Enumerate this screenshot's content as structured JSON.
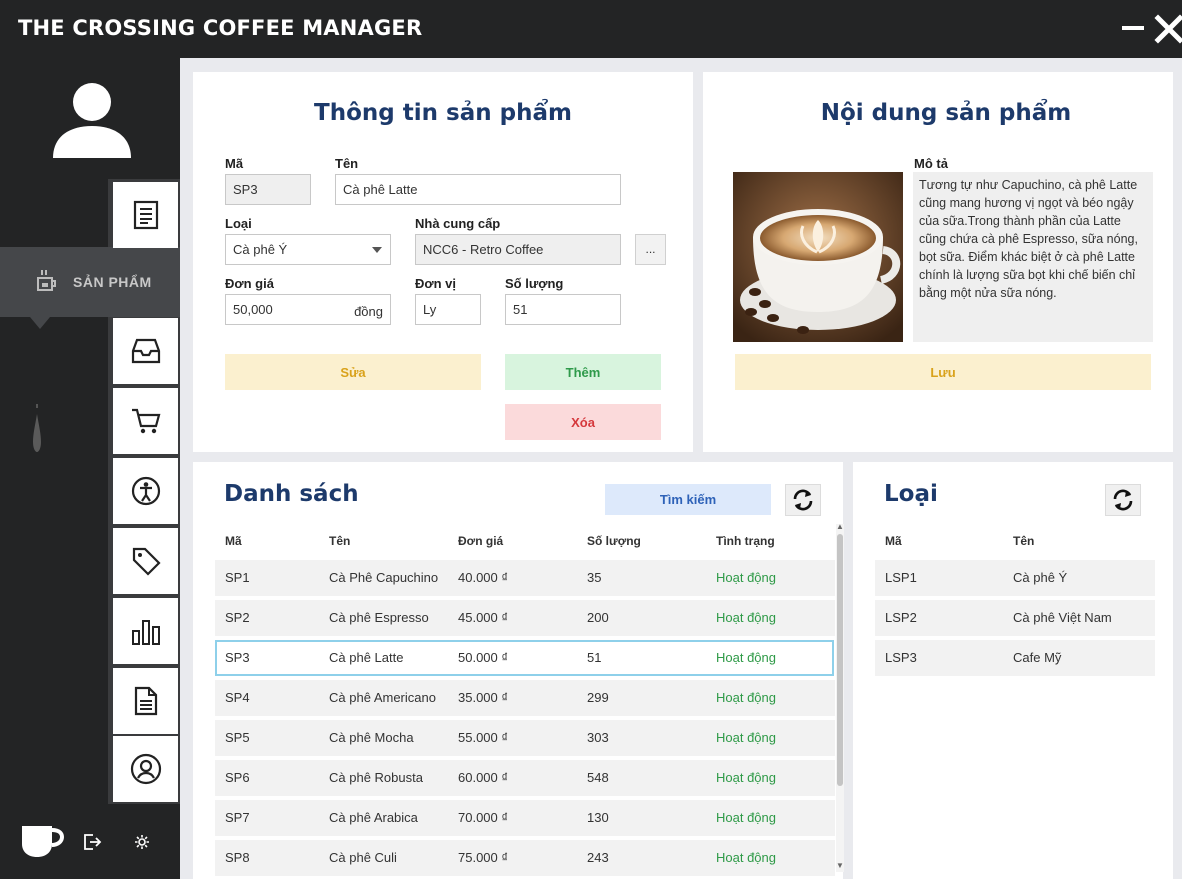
{
  "app": {
    "title": "THE CROSSING COFFEE MANAGER"
  },
  "sidebar": {
    "active_label": "SẢN PHẨM",
    "nav_items": [
      {
        "icon": "document-list-icon"
      },
      {
        "icon": "inbox-tray-icon"
      },
      {
        "icon": "cart-icon"
      },
      {
        "icon": "person-icon"
      },
      {
        "icon": "tag-icon"
      },
      {
        "icon": "bar-chart-icon"
      },
      {
        "icon": "file-text-icon"
      },
      {
        "icon": "user-circle-icon"
      }
    ]
  },
  "product_info": {
    "title": "Thông tin sản phẩm",
    "code_label": "Mã",
    "code_value": "SP3",
    "name_label": "Tên",
    "name_value": "Cà phê Latte",
    "type_label": "Loại",
    "type_value": "Cà phê Ý",
    "supplier_label": "Nhà cung cấp",
    "supplier_value": "NCC6 - Retro Coffee",
    "supplier_browse": "...",
    "price_label": "Đơn giá",
    "price_value": "50,000",
    "price_suffix": "đồng",
    "unit_label": "Đơn vị",
    "unit_value": "Ly",
    "qty_label": "Số lượng",
    "qty_value": "51",
    "edit_button": "Sửa",
    "add_button": "Thêm",
    "delete_button": "Xóa"
  },
  "product_content": {
    "title": "Nội dung sản phẩm",
    "desc_label": "Mô tả",
    "description": "Tương tự như Capuchino, cà phê Latte cũng mang hương vị ngọt và béo ngậy của sữa.Trong thành phần của Latte cũng chứa cà phê Espresso, sữa nóng, bọt sữa. Điểm khác biệt ở cà phê Latte chính là lượng sữa bọt khi chế biến chỉ bằng một nửa sữa nóng.",
    "save_button": "Lưu"
  },
  "product_list": {
    "title": "Danh sách",
    "search_button": "Tìm kiếm",
    "columns": [
      "Mã",
      "Tên",
      "Đơn giá",
      "Số lượng",
      "Tình trạng"
    ],
    "selected_index": 2,
    "rows": [
      [
        "SP1",
        "Cà Phê Capuchino",
        "40.000 ₫",
        "35",
        "Hoạt động"
      ],
      [
        "SP2",
        "Cà phê Espresso",
        "45.000 ₫",
        "200",
        "Hoạt động"
      ],
      [
        "SP3",
        "Cà phê Latte",
        "50.000 ₫",
        "51",
        "Hoạt động"
      ],
      [
        "SP4",
        "Cà phê Americano",
        "35.000 ₫",
        "299",
        "Hoạt động"
      ],
      [
        "SP5",
        "Cà phê Mocha",
        "55.000 ₫",
        "303",
        "Hoạt động"
      ],
      [
        "SP6",
        "Cà phê Robusta",
        "60.000 ₫",
        "548",
        "Hoạt động"
      ],
      [
        "SP7",
        "Cà phê Arabica",
        "70.000 ₫",
        "130",
        "Hoạt động"
      ],
      [
        "SP8",
        "Cà phê Culi",
        "75.000 ₫",
        "243",
        "Hoạt động"
      ]
    ]
  },
  "type_list": {
    "title": "Loại",
    "columns": [
      "Mã",
      "Tên"
    ],
    "rows": [
      [
        "LSP1",
        "Cà phê Ý"
      ],
      [
        "LSP2",
        "Cà phê Việt Nam"
      ],
      [
        "LSP3",
        "Cafe Mỹ"
      ]
    ]
  },
  "colors": {
    "sidebar_bg": "#232425",
    "title_blue": "#1d3a6b",
    "status_green": "#2e9a47",
    "selected_row_border": "#8ed0ea"
  }
}
